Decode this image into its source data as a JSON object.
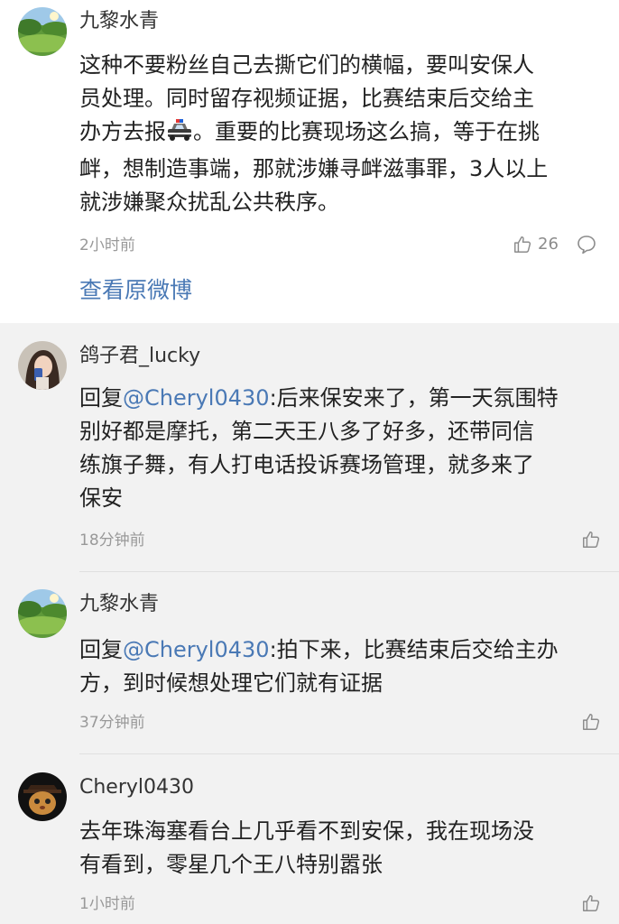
{
  "main_comment": {
    "username": "九黎水青",
    "lines": [
      "这种不要粉丝自己去撕它们的横幅，要叫安保人",
      "员处理。同时留存视频证据，比赛结束后交给主",
      "办方去报",
      "。重要的比赛现场这么搞，等于在挑",
      "衅，想制造事端，那就涉嫌寻衅滋事罪，3人以上",
      "就涉嫌聚众扰乱公共秩序。"
    ],
    "emoji": "police-car-icon",
    "time": "2小时前",
    "likes": "26",
    "view_original": "查看原微博"
  },
  "replies": [
    {
      "username": "鸽子君_lucky",
      "reply_prefix": "回复",
      "mention": "@Cheryl0430",
      "lines": [
        ":后来保安来了，第一天氛围特",
        "别好都是摩托，第二天王八多了好多，还带同信",
        "练旗子舞，有人打电话投诉赛场管理，就多来了",
        "保安"
      ],
      "time": "18分钟前"
    },
    {
      "username": "九黎水青",
      "reply_prefix": "回复",
      "mention": "@Cheryl0430",
      "lines": [
        ":拍下来，比赛结束后交给主办",
        "方，到时候想处理它们就有证据"
      ],
      "time": "37分钟前"
    },
    {
      "username": "Cheryl0430",
      "lines": [
        "去年珠海塞看台上几乎看不到安保，我在现场没",
        "有看到，零星几个王八特别嚣张"
      ],
      "time": "1小时前"
    }
  ],
  "colors": {
    "link": "#4a79b5",
    "reply_background": "#f2f2f2",
    "meta_text": "#999999"
  }
}
